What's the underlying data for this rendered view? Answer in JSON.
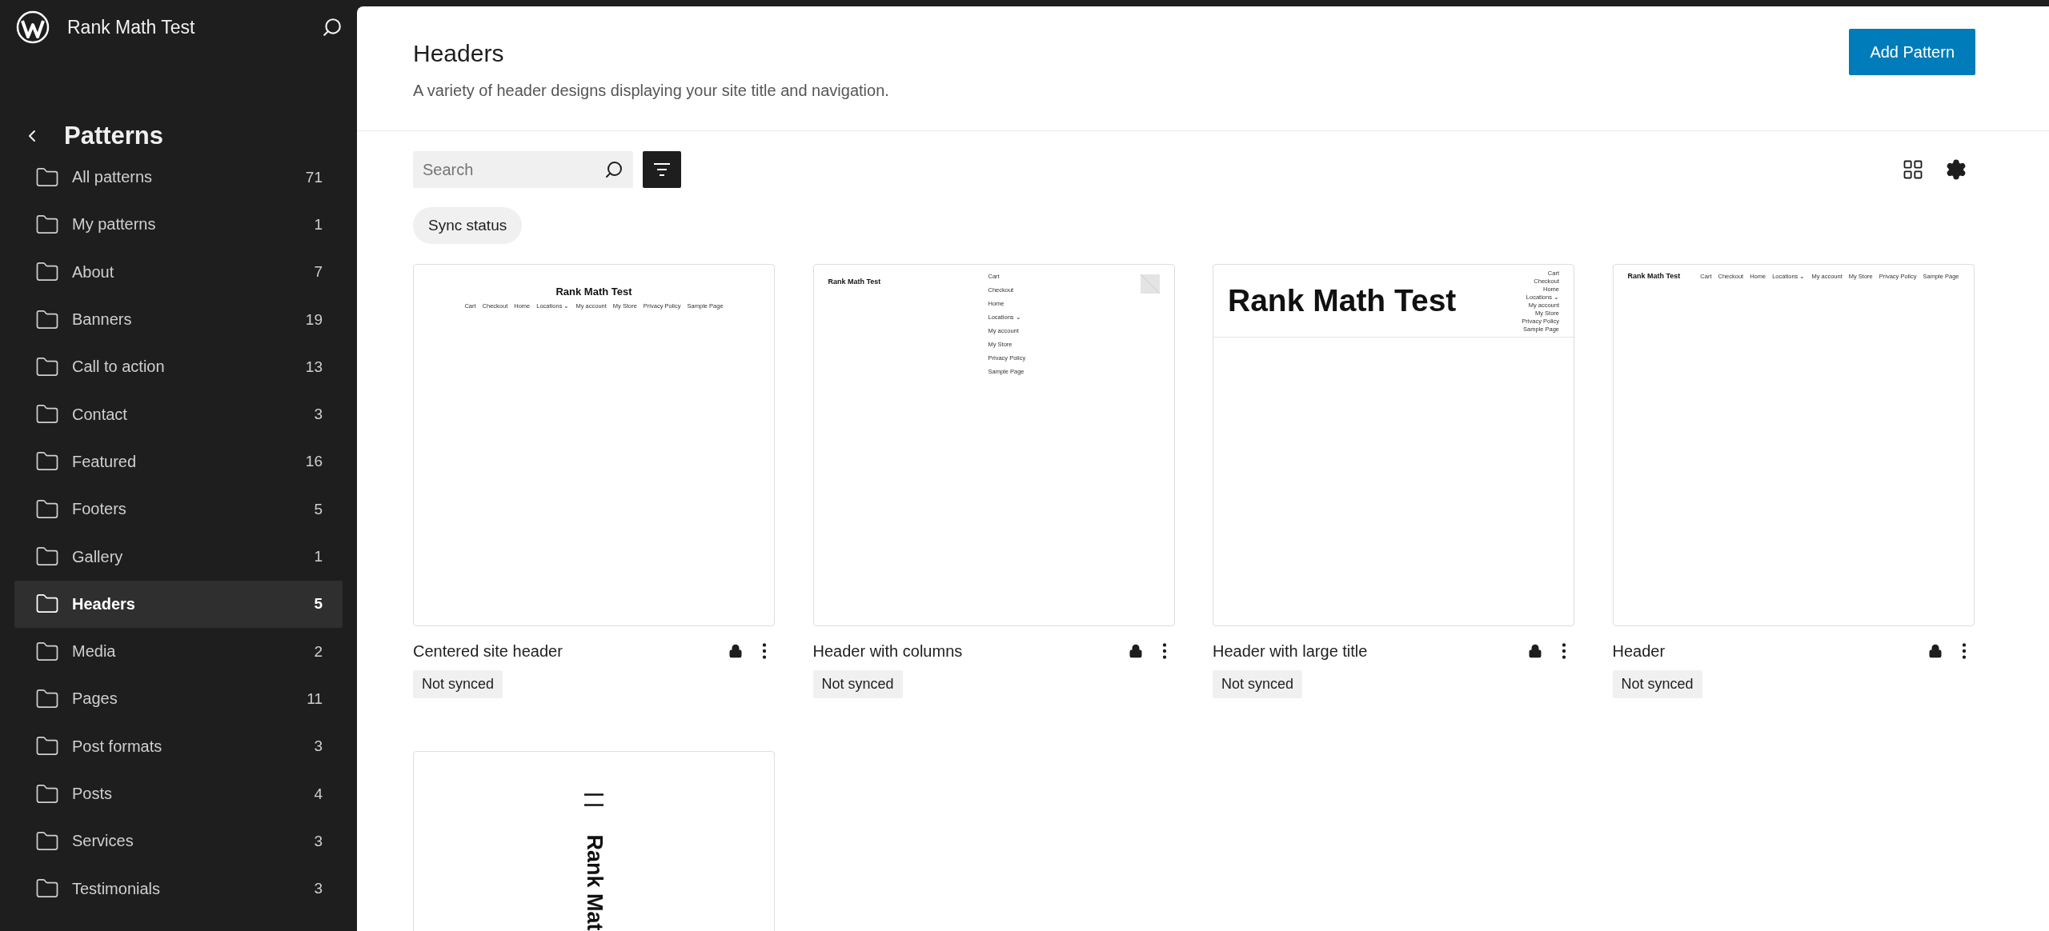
{
  "sidebar": {
    "site_title": "Rank Math Test",
    "section_title": "Patterns",
    "items": [
      {
        "label": "All patterns",
        "count": "71",
        "selected": false
      },
      {
        "label": "My patterns",
        "count": "1",
        "selected": false
      },
      {
        "label": "About",
        "count": "7",
        "selected": false
      },
      {
        "label": "Banners",
        "count": "19",
        "selected": false
      },
      {
        "label": "Call to action",
        "count": "13",
        "selected": false
      },
      {
        "label": "Contact",
        "count": "3",
        "selected": false
      },
      {
        "label": "Featured",
        "count": "16",
        "selected": false
      },
      {
        "label": "Footers",
        "count": "5",
        "selected": false
      },
      {
        "label": "Gallery",
        "count": "1",
        "selected": false
      },
      {
        "label": "Headers",
        "count": "5",
        "selected": true
      },
      {
        "label": "Media",
        "count": "2",
        "selected": false
      },
      {
        "label": "Pages",
        "count": "11",
        "selected": false
      },
      {
        "label": "Post formats",
        "count": "3",
        "selected": false
      },
      {
        "label": "Posts",
        "count": "4",
        "selected": false
      },
      {
        "label": "Services",
        "count": "3",
        "selected": false
      },
      {
        "label": "Testimonials",
        "count": "3",
        "selected": false
      }
    ]
  },
  "header": {
    "title": "Headers",
    "description": "A variety of header designs displaying your site title and navigation.",
    "add_button": "Add Pattern"
  },
  "toolbar": {
    "search_placeholder": "Search",
    "filter_chip": "Sync status"
  },
  "patterns": [
    {
      "title": "Centered site header",
      "locked": true,
      "badge": "Not synced",
      "preview": {
        "kind": "centered",
        "site_title": "Rank Math Test",
        "nav": [
          "Cart",
          "Checkout",
          "Home",
          "Locations ⌄",
          "My account",
          "My Store",
          "Privacy Policy",
          "Sample Page"
        ]
      }
    },
    {
      "title": "Header with columns",
      "locked": true,
      "badge": "Not synced",
      "preview": {
        "kind": "columns",
        "site_title": "Rank Math Test",
        "nav": [
          "Cart",
          "Checkout",
          "Home",
          "Locations ⌄",
          "My account",
          "My Store",
          "Privacy Policy",
          "Sample Page"
        ]
      }
    },
    {
      "title": "Header with large title",
      "locked": true,
      "badge": "Not synced",
      "preview": {
        "kind": "large",
        "site_title": "Rank Math Test",
        "nav": [
          "Cart",
          "Checkout",
          "Home",
          "Locations ⌄",
          "My account",
          "My Store",
          "Privacy Policy",
          "Sample Page"
        ]
      }
    },
    {
      "title": "Header",
      "locked": true,
      "badge": "Not synced",
      "preview": {
        "kind": "inline",
        "site_title": "Rank Math Test",
        "nav": [
          "Cart",
          "Checkout",
          "Home",
          "Locations ⌄",
          "My account",
          "My Store",
          "Privacy Policy",
          "Sample Page"
        ]
      }
    },
    {
      "preview": {
        "kind": "vertical",
        "site_title": "Rank Mat"
      }
    }
  ]
}
